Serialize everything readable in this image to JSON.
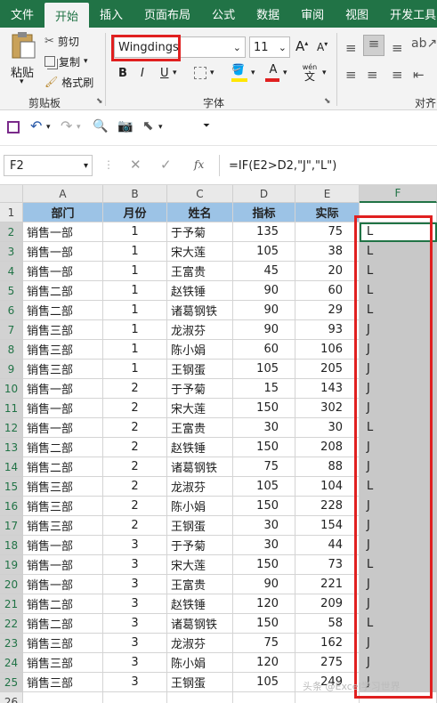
{
  "tabs": [
    "文件",
    "开始",
    "插入",
    "页面布局",
    "公式",
    "数据",
    "审阅",
    "视图",
    "开发工具"
  ],
  "clipboard": {
    "paste": "粘贴",
    "cut": "剪切",
    "copy": "复制",
    "format_painter": "格式刷",
    "group": "剪贴板"
  },
  "font": {
    "name": "Wingdings",
    "size": "11",
    "group": "字体",
    "bold": "B",
    "italic": "I",
    "underline": "U",
    "grow": "A",
    "shrink": "A",
    "wen": "wén",
    "wen_char": "文"
  },
  "align_group": "对齐",
  "formula_bar": {
    "name_box": "F2",
    "fx": "fx",
    "formula": "=IF(E2>D2,\"J\",\"L\")"
  },
  "columns": [
    "A",
    "B",
    "C",
    "D",
    "E",
    "F"
  ],
  "headers": [
    "部门",
    "月份",
    "姓名",
    "指标",
    "实际"
  ],
  "rows": [
    [
      "销售一部",
      "1",
      "于予菊",
      "135",
      "75",
      "L"
    ],
    [
      "销售一部",
      "1",
      "宋大莲",
      "105",
      "38",
      "L"
    ],
    [
      "销售一部",
      "1",
      "王富贵",
      "45",
      "20",
      "L"
    ],
    [
      "销售二部",
      "1",
      "赵铁锤",
      "90",
      "60",
      "L"
    ],
    [
      "销售二部",
      "1",
      "诸葛钢铁",
      "90",
      "29",
      "L"
    ],
    [
      "销售三部",
      "1",
      "龙淑芬",
      "90",
      "93",
      "J"
    ],
    [
      "销售三部",
      "1",
      "陈小娟",
      "60",
      "106",
      "J"
    ],
    [
      "销售三部",
      "1",
      "王钢蛋",
      "105",
      "205",
      "J"
    ],
    [
      "销售一部",
      "2",
      "于予菊",
      "15",
      "143",
      "J"
    ],
    [
      "销售一部",
      "2",
      "宋大莲",
      "150",
      "302",
      "J"
    ],
    [
      "销售一部",
      "2",
      "王富贵",
      "30",
      "30",
      "L"
    ],
    [
      "销售二部",
      "2",
      "赵铁锤",
      "150",
      "208",
      "J"
    ],
    [
      "销售二部",
      "2",
      "诸葛钢铁",
      "75",
      "88",
      "J"
    ],
    [
      "销售三部",
      "2",
      "龙淑芬",
      "105",
      "104",
      "L"
    ],
    [
      "销售三部",
      "2",
      "陈小娟",
      "150",
      "228",
      "J"
    ],
    [
      "销售三部",
      "2",
      "王钢蛋",
      "30",
      "154",
      "J"
    ],
    [
      "销售一部",
      "3",
      "于予菊",
      "30",
      "44",
      "J"
    ],
    [
      "销售一部",
      "3",
      "宋大莲",
      "150",
      "73",
      "L"
    ],
    [
      "销售一部",
      "3",
      "王富贵",
      "90",
      "221",
      "J"
    ],
    [
      "销售二部",
      "3",
      "赵铁锤",
      "120",
      "209",
      "J"
    ],
    [
      "销售二部",
      "3",
      "诸葛钢铁",
      "150",
      "58",
      "L"
    ],
    [
      "销售三部",
      "3",
      "龙淑芬",
      "75",
      "162",
      "J"
    ],
    [
      "销售三部",
      "3",
      "陈小娟",
      "120",
      "275",
      "J"
    ],
    [
      "销售三部",
      "3",
      "王钢蛋",
      "105",
      "249",
      "J"
    ]
  ],
  "watermark": "头条 @Excel学习世界",
  "colors": {
    "ribbon_green": "#217346",
    "header_fill": "#9cc3e6",
    "selection": "#c8c8c8",
    "highlight_red": "#e02020"
  }
}
